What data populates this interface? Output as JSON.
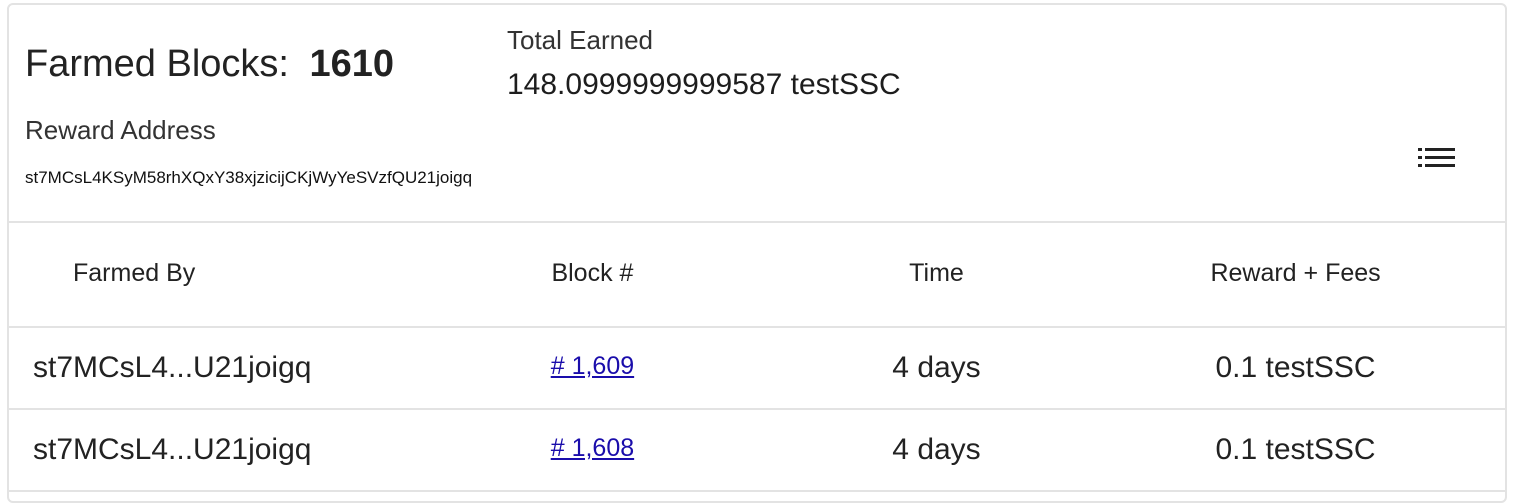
{
  "summary": {
    "farmed_blocks_label": "Farmed Blocks:",
    "farmed_blocks_count": "1610",
    "total_earned_label": "Total Earned",
    "total_earned_value": "148.0999999999587 testSSC",
    "reward_address_label": "Reward Address",
    "reward_address": "st7MCsL4KSyM58rhXQxY38xjzicijCKjWyYeSVzfQU21joigq",
    "menu_icon": "list-icon"
  },
  "table": {
    "headers": [
      "Farmed By",
      "Block #",
      "Time",
      "Reward + Fees"
    ],
    "rows": [
      {
        "farmed_by": "st7MCsL4...U21joigq",
        "block": "# 1,609",
        "time": "4 days",
        "reward": "0.1 testSSC"
      },
      {
        "farmed_by": "st7MCsL4...U21joigq",
        "block": "# 1,608",
        "time": "4 days",
        "reward": "0.1 testSSC"
      }
    ]
  },
  "colors": {
    "border": "#e3e3e3",
    "link": "#1a0dab",
    "text": "#212121"
  }
}
